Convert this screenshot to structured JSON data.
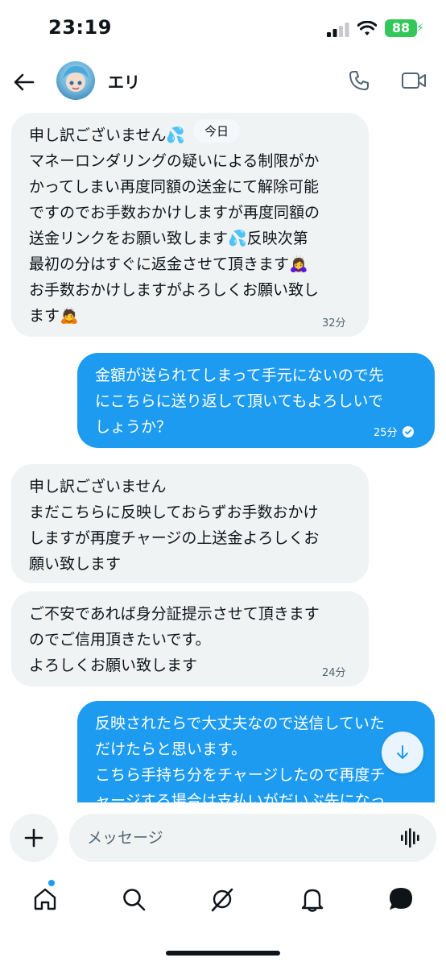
{
  "status": {
    "time": "23:19",
    "battery": "88"
  },
  "header": {
    "contact_name": "エリ",
    "back_icon": "arrow-left-icon",
    "call_icon": "phone-icon",
    "video_icon": "video-icon"
  },
  "date_divider": "今日",
  "messages": [
    {
      "direction": "in",
      "lines": [
        "申し訳ございません💦",
        "マネーロンダリングの疑いによる制限がか",
        "かってしまい再度同額の送金にて解除可能",
        "ですのでお手数おかけしますが再度同額の",
        "送金リンクをお願い致します💦反映次第",
        "最初の分はすぐに返金させて頂きます🙇‍♀️",
        "お手数おかけしますがよろしくお願い致し",
        "ます🙇"
      ],
      "time": "32分"
    },
    {
      "direction": "out",
      "lines": [
        "金額が送られてしまって手元にないので先",
        "にこちらに送り返して頂いてもよろしいで",
        "しょうか？"
      ],
      "time": "25分",
      "status": "read"
    },
    {
      "direction": "in",
      "lines": [
        "申し訳ございません",
        "まだこちらに反映しておらずお手数おかけ",
        "しますが再度チャージの上送金よろしくお",
        "願い致します"
      ],
      "time": ""
    },
    {
      "direction": "in",
      "lines": [
        "ご不安であれば身分証提示させて頂きます",
        "のでご信用頂きたいです。",
        "よろしくお願い致します"
      ],
      "time": "24分"
    },
    {
      "direction": "out",
      "lines": [
        "反映されたらで大丈夫なので送信していた",
        "だけたらと思います。",
        "こちら手持ち分をチャージしたので再度チ",
        "ャージする場合は支払いがだいぶ先になっ"
      ],
      "time": ""
    }
  ],
  "composer": {
    "placeholder": "メッセージ"
  },
  "nav": {
    "items": [
      "home-icon",
      "search-icon",
      "grok-icon",
      "notifications-icon",
      "messages-icon"
    ]
  },
  "colors": {
    "accent": "#1d9bf0",
    "incoming_bubble": "#eff3f4",
    "text": "#0f1419",
    "muted": "#536471"
  }
}
